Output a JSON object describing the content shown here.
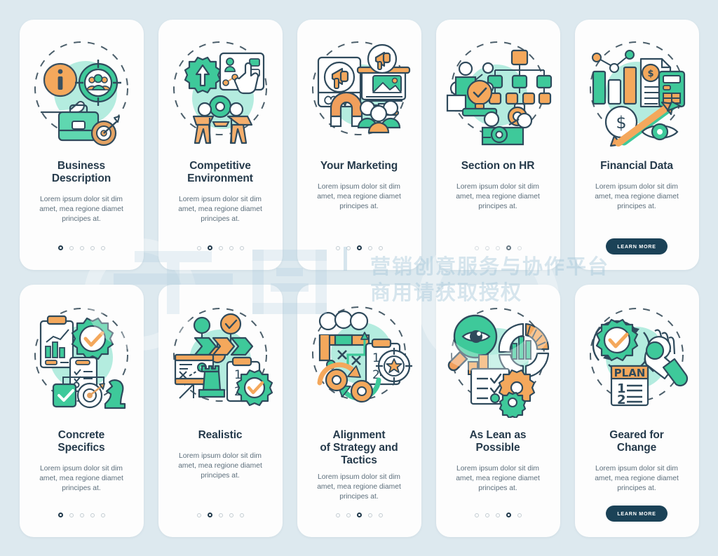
{
  "page": {
    "background_color": "#dde9ef",
    "card_background": "#fdfdfd",
    "title_color": "#253a4b",
    "body_color": "#5d6f7c",
    "accent_green": "#3ec99a",
    "accent_green_light": "#a8e7d8",
    "accent_orange": "#f4a85c",
    "accent_dark": "#1b4257",
    "dot_inactive": "#c3ccd2",
    "dot_active": "#20394b"
  },
  "watermark": {
    "brand": "千图",
    "tagline": "营销创意服务与协作平台",
    "notice": "商用请获取授权"
  },
  "lorem": "Lorem ipsum dolor sit dim amet, mea regione diamet principes at.",
  "cards": [
    {
      "id": "business-description",
      "title": "Business\nDescription",
      "title_lines": [
        "Business",
        "Description"
      ],
      "description": "Lorem ipsum dolor sit dim amet, mea regione diamet principes at.",
      "dots": 5,
      "active_dot": 1,
      "has_button": false,
      "button_label": "",
      "icon_names": [
        "info-icon",
        "hand-icon",
        "target-people-icon",
        "briefcase-icon",
        "target-arrow-icon"
      ]
    },
    {
      "id": "competitive-environment",
      "title": "Competitive\nEnvironment",
      "title_lines": [
        "Competitive",
        "Environment"
      ],
      "description": "Lorem ipsum dolor sit dim amet, mea regione diamet principes at.",
      "dots": 5,
      "active_dot": 2,
      "has_button": false,
      "button_label": "",
      "icon_names": [
        "gear-arrow-up-icon",
        "dashboard-icon",
        "pointing-hand-icon",
        "handshake-people-icon",
        "gear-icon"
      ]
    },
    {
      "id": "your-marketing",
      "title": "Your Marketing",
      "title_lines": [
        "Your Marketing"
      ],
      "description": "Lorem ipsum dolor sit dim amet, mea regione diamet principes at.",
      "dots": 5,
      "active_dot": 3,
      "has_button": false,
      "button_label": "",
      "icon_names": [
        "megaphone-icon",
        "social-post-icon",
        "monitor-icon",
        "magnet-icon",
        "people-group-icon"
      ]
    },
    {
      "id": "section-on-hr",
      "title": "Section on HR",
      "title_lines": [
        "Section on HR"
      ],
      "description": "Lorem ipsum dolor sit dim amet, mea regione diamet principes at.",
      "dots": 5,
      "active_dot": 4,
      "has_button": false,
      "button_label": "",
      "icon_names": [
        "org-chart-icon",
        "lightbulb-check-icon",
        "people-icon",
        "gear-hand-icon"
      ]
    },
    {
      "id": "financial-data",
      "title": "Financial Data",
      "title_lines": [
        "Financial Data"
      ],
      "description": "Lorem ipsum dolor sit dim amet, mea regione diamet principes at.",
      "dots": 0,
      "active_dot": 0,
      "has_button": true,
      "button_label": "LEARN MORE",
      "icon_names": [
        "bar-chart-icon",
        "line-chart-icon",
        "invoice-icon",
        "calculator-icon",
        "dollar-coin-icon",
        "trend-arrows-icon",
        "eye-icon"
      ]
    },
    {
      "id": "concrete-specifics",
      "title": "Concrete\nSpecifics",
      "title_lines": [
        "Concrete",
        "Specifics"
      ],
      "description": "Lorem ipsum dolor sit dim amet, mea regione diamet principes at.",
      "dots": 5,
      "active_dot": 1,
      "has_button": false,
      "button_label": "",
      "icon_names": [
        "clipboard-chart-icon",
        "gear-check-icon",
        "checklist-icon",
        "check-square-icon",
        "target-arrow-icon",
        "chess-knight-icon"
      ]
    },
    {
      "id": "realistic",
      "title": "Realistic",
      "title_lines": [
        "Realistic"
      ],
      "description": "Lorem ipsum dolor sit dim amet, mea regione diamet principes at.",
      "dots": 5,
      "active_dot": 2,
      "has_button": false,
      "button_label": "",
      "icon_names": [
        "arrow-flow-icon",
        "check-circle-icon",
        "whiteboard-icon",
        "chess-rook-icon",
        "clipboard-list-icon",
        "gear-check-icon"
      ]
    },
    {
      "id": "alignment-of-strategy-and-tactics",
      "title": "Alignment\nof Strategy and\nTactics",
      "title_lines": [
        "Alignment",
        "of Strategy and",
        "Tactics"
      ],
      "description": "Lorem ipsum dolor sit dim amet, mea regione diamet principes at.",
      "dots": 5,
      "active_dot": 3,
      "has_button": false,
      "button_label": "",
      "icon_names": [
        "team-strategy-icon",
        "clipboard-star-icon",
        "gear-cycle-icon"
      ]
    },
    {
      "id": "as-lean-as-possible",
      "title": "As Lean as\nPossible",
      "title_lines": [
        "As Lean as",
        "Possible"
      ],
      "description": "Lorem ipsum dolor sit dim amet, mea regione diamet principes at.",
      "dots": 5,
      "active_dot": 4,
      "has_button": false,
      "button_label": "",
      "icon_names": [
        "magnifier-eye-icon",
        "bar-chart-icon",
        "donut-chart-icon",
        "checklist-icon",
        "gear-icon"
      ]
    },
    {
      "id": "geared-for-change",
      "title": "Geared for\nChange",
      "title_lines": [
        "Geared for",
        "Change"
      ],
      "description": "Lorem ipsum dolor sit dim amet, mea regione diamet principes at.",
      "dots": 0,
      "active_dot": 0,
      "has_button": true,
      "button_label": "LEARN MORE",
      "icon_names": [
        "gear-check-cycle-icon",
        "plan-document-icon",
        "ok-hand-icon"
      ]
    }
  ]
}
